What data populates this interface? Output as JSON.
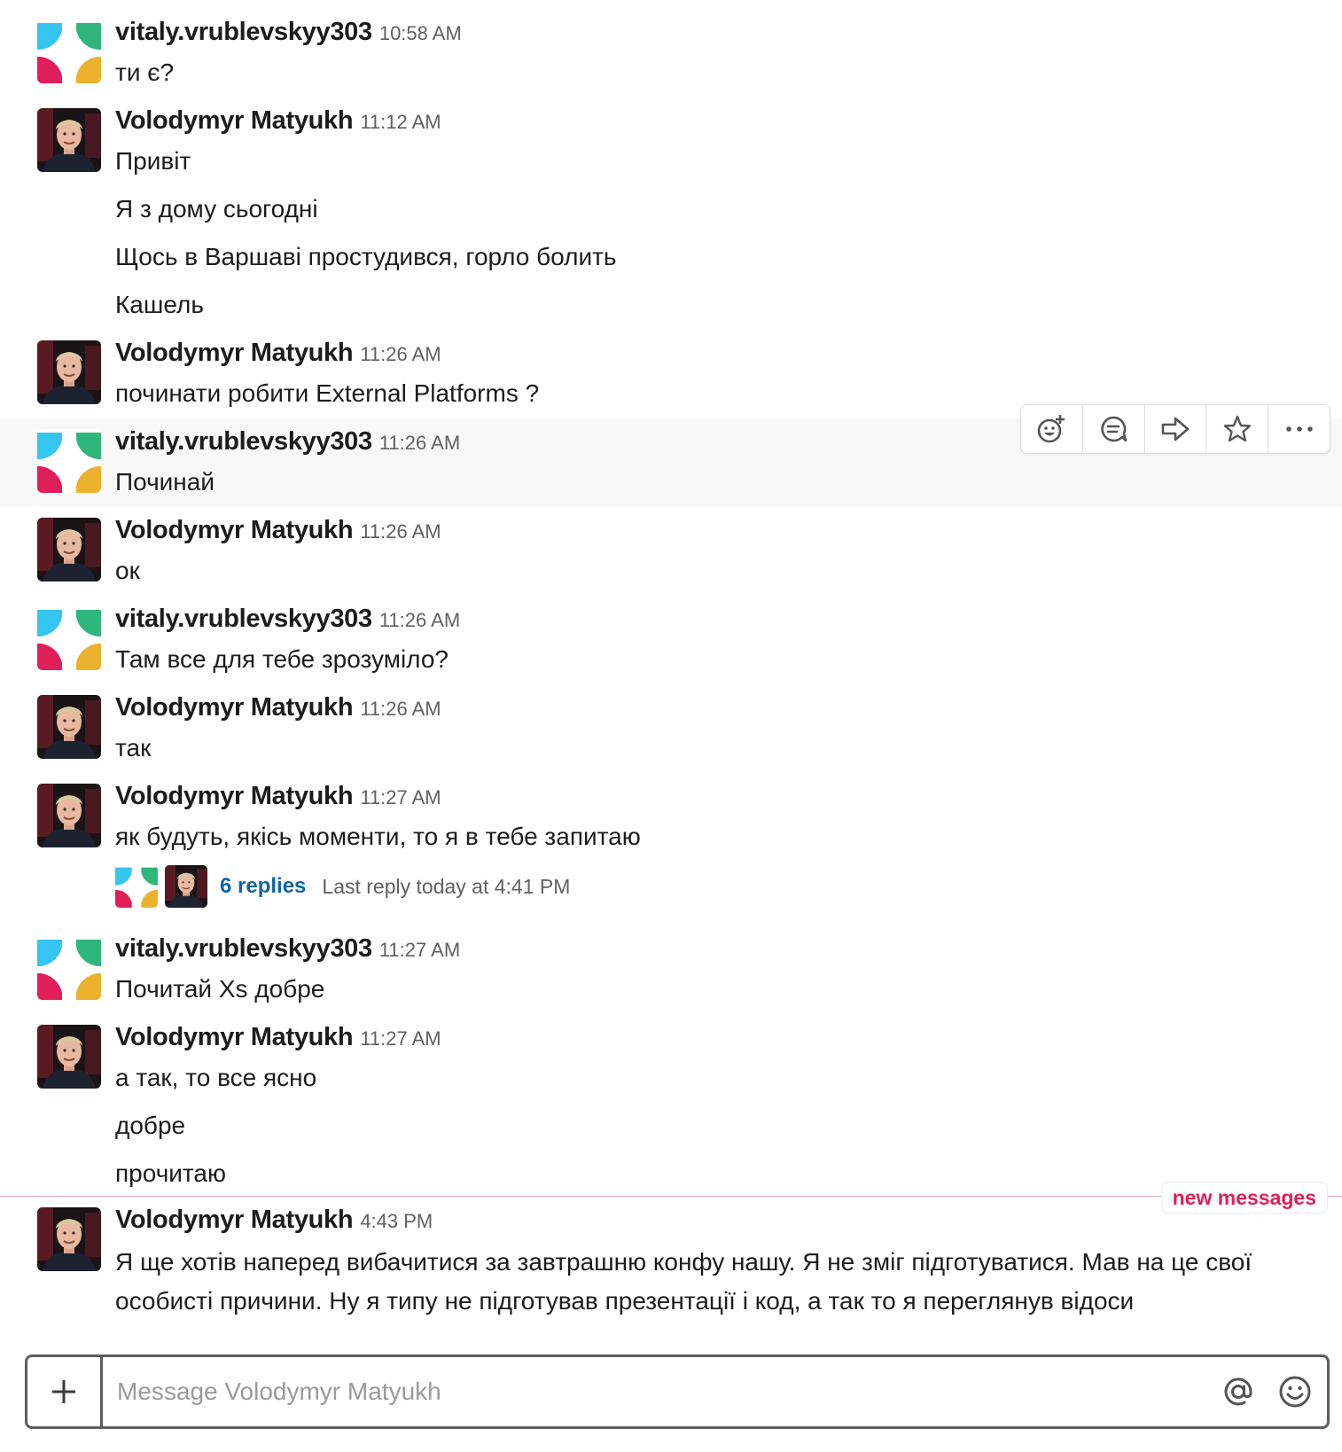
{
  "users": {
    "vitaly": "vitaly.vrublevskyy303",
    "volodymyr": "Volodymyr Matyukh"
  },
  "messages": [
    {
      "author": "vitaly.vrublevskyy303",
      "time": "10:58 AM",
      "lines": [
        "ти є?"
      ]
    },
    {
      "author": "Volodymyr Matyukh",
      "time": "11:12 AM",
      "lines": [
        "Привіт",
        "Я з дому сьогодні",
        "Щось в Варшаві простудився, горло болить",
        "Кашель"
      ]
    },
    {
      "author": "Volodymyr Matyukh",
      "time": "11:26 AM",
      "lines": [
        "починати робити External Platforms ?"
      ]
    },
    {
      "author": "vitaly.vrublevskyy303",
      "time": "11:26 AM",
      "lines": [
        "Починай"
      ]
    },
    {
      "author": "Volodymyr Matyukh",
      "time": "11:26 AM",
      "lines": [
        "ок"
      ]
    },
    {
      "author": "vitaly.vrublevskyy303",
      "time": "11:26 AM",
      "lines": [
        "Там все для тебе зрозуміло?"
      ]
    },
    {
      "author": "Volodymyr Matyukh",
      "time": "11:26 AM",
      "lines": [
        "так"
      ]
    },
    {
      "author": "Volodymyr Matyukh",
      "time": "11:27 AM",
      "lines": [
        "як будуть, якісь моменти, то я в тебе запитаю"
      ]
    },
    {
      "author": "vitaly.vrublevskyy303",
      "time": "11:27 AM",
      "lines": [
        "Почитай Xs добре"
      ]
    },
    {
      "author": "Volodymyr Matyukh",
      "time": "11:27 AM",
      "lines": [
        "а так, то все ясно",
        "добре",
        "прочитаю"
      ]
    },
    {
      "author": "Volodymyr Matyukh",
      "time": "4:43 PM",
      "lines": [
        "Я ще хотів наперед вибачитися за завтрашню конфу нашу. Я не зміг підготуватися. Мав на це свої особисті причини. Ну я типу не підготував презентації і код, а так то я переглянув відоси"
      ]
    }
  ],
  "thread": {
    "replies": "6 replies",
    "last_reply": "Last reply today at 4:41 PM"
  },
  "new_messages_label": "new messages",
  "composer": {
    "placeholder": "Message Volodymyr Matyukh"
  },
  "toolbar_icons": [
    "add-reaction-icon",
    "reply-thread-icon",
    "share-icon",
    "star-icon",
    "more-actions-icon"
  ],
  "colors": {
    "link": "#1264a3",
    "new_messages": "#e01e5a",
    "avatar_blue": "#36c5f0",
    "avatar_green": "#2eb67d",
    "avatar_red": "#e01e5a",
    "avatar_yellow": "#ecb22e"
  }
}
